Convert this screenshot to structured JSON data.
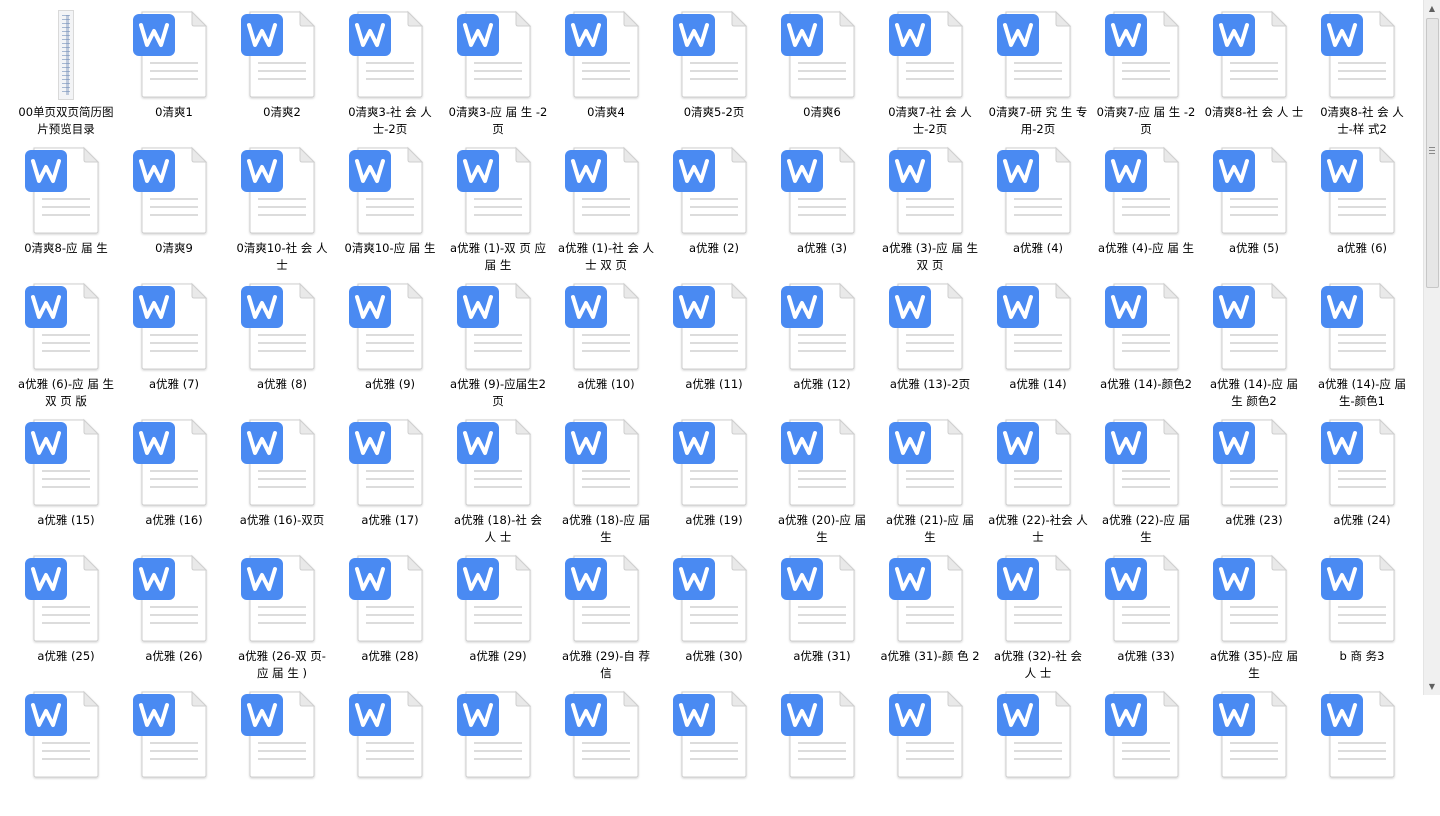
{
  "window": {
    "title": ""
  },
  "icons": {
    "file_icon": "wps-writer-doc-icon",
    "image_icon": "image-thumbnail-icon",
    "accent": "#4a8af2"
  },
  "files": [
    {
      "name": "00单页双页简历图片预览目录",
      "type": "image"
    },
    {
      "name": "0清爽1",
      "type": "doc"
    },
    {
      "name": "0清爽2",
      "type": "doc"
    },
    {
      "name": "0清爽3-社 会 人 士-2页",
      "type": "doc"
    },
    {
      "name": "0清爽3-应 届 生 -2页",
      "type": "doc"
    },
    {
      "name": "0清爽4",
      "type": "doc"
    },
    {
      "name": "0清爽5-2页",
      "type": "doc"
    },
    {
      "name": "0清爽6",
      "type": "doc"
    },
    {
      "name": "0清爽7-社 会 人 士-2页",
      "type": "doc"
    },
    {
      "name": "0清爽7-研 究 生 专 用-2页",
      "type": "doc"
    },
    {
      "name": "0清爽7-应 届 生 -2页",
      "type": "doc"
    },
    {
      "name": "0清爽8-社 会 人 士",
      "type": "doc"
    },
    {
      "name": "0清爽8-社 会 人 士-样 式2",
      "type": "doc"
    },
    {
      "name": "0清爽8-应 届 生",
      "type": "doc"
    },
    {
      "name": "0清爽9",
      "type": "doc"
    },
    {
      "name": "0清爽10-社 会 人 士",
      "type": "doc"
    },
    {
      "name": "0清爽10-应 届 生",
      "type": "doc"
    },
    {
      "name": "a优雅 (1)-双 页 应 届 生",
      "type": "doc"
    },
    {
      "name": "a优雅 (1)-社 会 人 士 双 页",
      "type": "doc"
    },
    {
      "name": "a优雅 (2)",
      "type": "doc"
    },
    {
      "name": "a优雅 (3)",
      "type": "doc"
    },
    {
      "name": "a优雅 (3)-应 届 生 双 页",
      "type": "doc"
    },
    {
      "name": "a优雅 (4)",
      "type": "doc"
    },
    {
      "name": "a优雅 (4)-应 届 生",
      "type": "doc"
    },
    {
      "name": "a优雅 (5)",
      "type": "doc"
    },
    {
      "name": "a优雅 (6)",
      "type": "doc"
    },
    {
      "name": "a优雅 (6)-应 届 生 双 页 版",
      "type": "doc"
    },
    {
      "name": "a优雅 (7)",
      "type": "doc"
    },
    {
      "name": "a优雅 (8)",
      "type": "doc"
    },
    {
      "name": "a优雅 (9)",
      "type": "doc"
    },
    {
      "name": "a优雅 (9)-应届生2页",
      "type": "doc"
    },
    {
      "name": "a优雅 (10)",
      "type": "doc"
    },
    {
      "name": "a优雅 (11)",
      "type": "doc"
    },
    {
      "name": "a优雅 (12)",
      "type": "doc"
    },
    {
      "name": "a优雅 (13)-2页",
      "type": "doc"
    },
    {
      "name": "a优雅 (14)",
      "type": "doc"
    },
    {
      "name": "a优雅 (14)-颜色2",
      "type": "doc"
    },
    {
      "name": "a优雅 (14)-应 届 生 颜色2",
      "type": "doc"
    },
    {
      "name": "a优雅 (14)-应 届 生-颜色1",
      "type": "doc"
    },
    {
      "name": "a优雅 (15)",
      "type": "doc"
    },
    {
      "name": "a优雅 (16)",
      "type": "doc"
    },
    {
      "name": "a优雅 (16)-双页",
      "type": "doc"
    },
    {
      "name": "a优雅 (17)",
      "type": "doc"
    },
    {
      "name": "a优雅 (18)-社 会 人 士",
      "type": "doc"
    },
    {
      "name": "a优雅 (18)-应 届 生",
      "type": "doc"
    },
    {
      "name": "a优雅 (19)",
      "type": "doc"
    },
    {
      "name": "a优雅 (20)-应 届 生",
      "type": "doc"
    },
    {
      "name": "a优雅 (21)-应 届 生",
      "type": "doc"
    },
    {
      "name": "a优雅 (22)-社会 人士",
      "type": "doc"
    },
    {
      "name": "a优雅 (22)-应 届 生",
      "type": "doc"
    },
    {
      "name": "a优雅 (23)",
      "type": "doc"
    },
    {
      "name": "a优雅 (24)",
      "type": "doc"
    },
    {
      "name": "a优雅 (25)",
      "type": "doc"
    },
    {
      "name": "a优雅 (26)",
      "type": "doc"
    },
    {
      "name": "a优雅 (26-双 页- 应 届 生 )",
      "type": "doc"
    },
    {
      "name": "a优雅 (28)",
      "type": "doc"
    },
    {
      "name": "a优雅 (29)",
      "type": "doc"
    },
    {
      "name": "a优雅 (29)-自 荐 信",
      "type": "doc"
    },
    {
      "name": "a优雅 (30)",
      "type": "doc"
    },
    {
      "name": "a优雅 (31)",
      "type": "doc"
    },
    {
      "name": "a优雅 (31)-颜 色 2",
      "type": "doc"
    },
    {
      "name": "a优雅 (32)-社 会 人 士",
      "type": "doc"
    },
    {
      "name": "a优雅 (33)",
      "type": "doc"
    },
    {
      "name": "a优雅 (35)-应 届 生",
      "type": "doc"
    },
    {
      "name": "b 商 务3",
      "type": "doc"
    },
    {
      "name": "",
      "type": "doc"
    },
    {
      "name": "",
      "type": "doc"
    },
    {
      "name": "",
      "type": "doc"
    },
    {
      "name": "",
      "type": "doc"
    },
    {
      "name": "",
      "type": "doc"
    },
    {
      "name": "",
      "type": "doc"
    },
    {
      "name": "",
      "type": "doc"
    },
    {
      "name": "",
      "type": "doc"
    },
    {
      "name": "",
      "type": "doc"
    },
    {
      "name": "",
      "type": "doc"
    },
    {
      "name": "",
      "type": "doc"
    },
    {
      "name": "",
      "type": "doc"
    },
    {
      "name": "",
      "type": "doc"
    }
  ],
  "scrollbar": {
    "position_fraction": 0.0
  }
}
